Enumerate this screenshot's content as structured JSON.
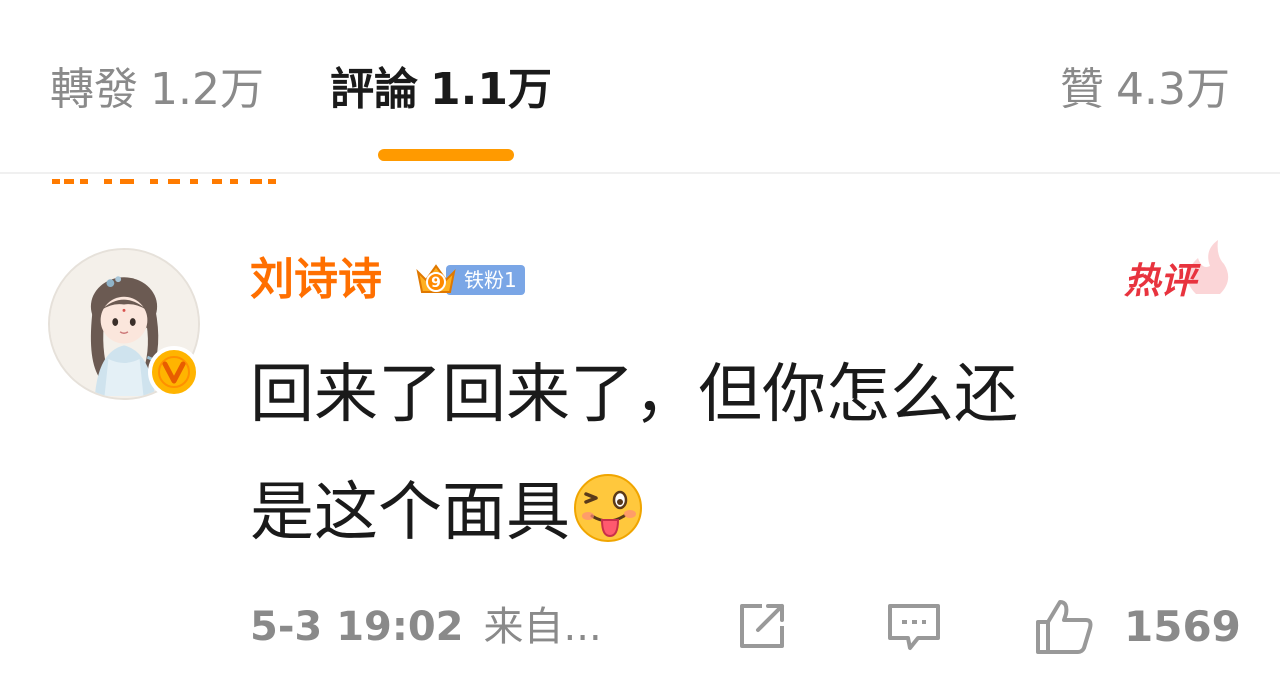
{
  "tabs": {
    "repost": {
      "label": "轉發",
      "count": "1.2万"
    },
    "comment": {
      "label": "評論",
      "count": "1.1万",
      "active": true
    },
    "like": {
      "label": "贊",
      "count": "4.3万"
    }
  },
  "colors": {
    "accent": "#ff9a00",
    "username": "#ff6f00",
    "hot": "#e8333e",
    "fan_badge": "#7aa6e6"
  },
  "comment": {
    "username": "刘诗诗",
    "fan_badge": "铁粉1",
    "fan_level": "9",
    "verified_icon": "v-verified-icon",
    "hot_label": "热评",
    "text_line1": "回来了回来了，但你怎么还",
    "text_line2": "是这个面具",
    "emoji": "tongue-wink-emoji",
    "timestamp": "5-3 19:02",
    "source": "来自...",
    "like_count": "1569"
  },
  "icons": {
    "share": "share-icon",
    "reply": "comment-icon",
    "like": "thumbs-up-icon"
  }
}
